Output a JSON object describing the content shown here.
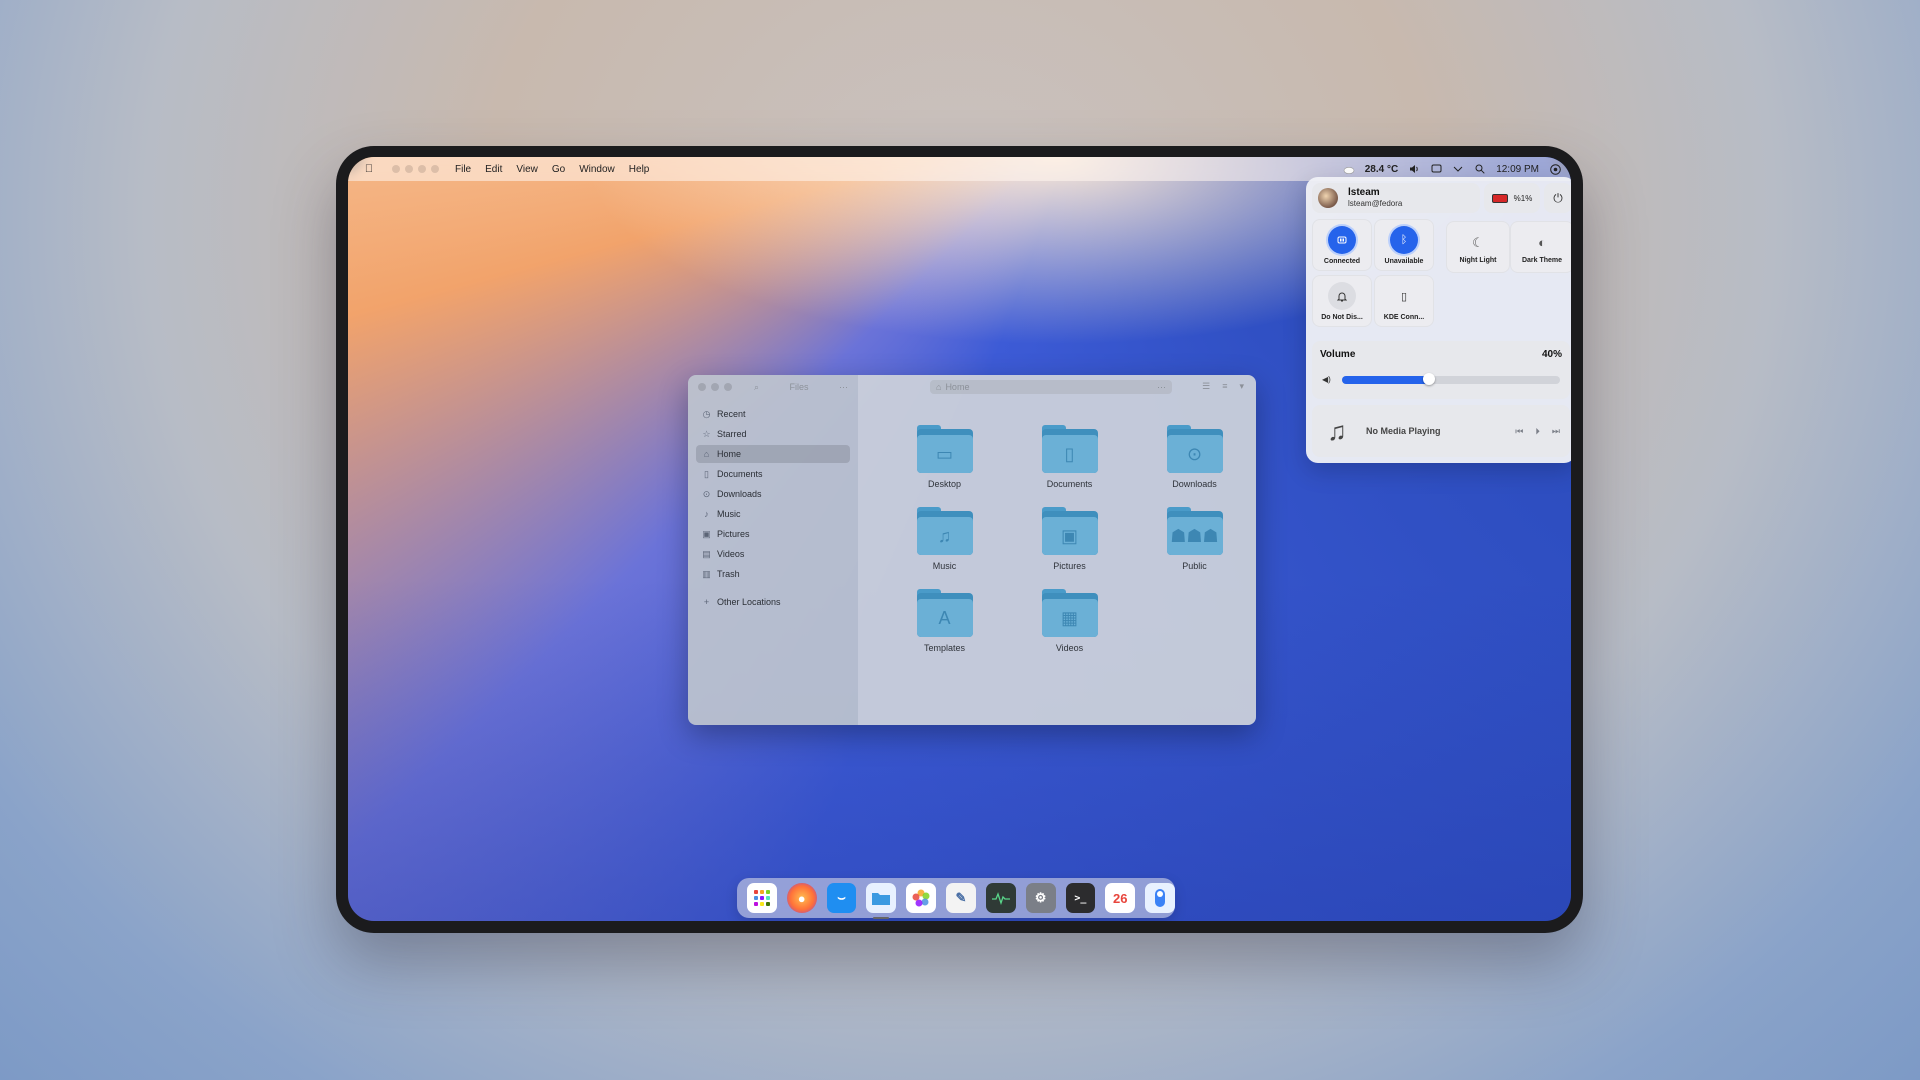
{
  "menubar": {
    "menus": [
      "File",
      "Edit",
      "View",
      "Go",
      "Window",
      "Help"
    ],
    "temperature": "28.4 °C",
    "clock": "12:09 PM"
  },
  "files": {
    "sidebar_title": "Files",
    "path": "Home",
    "sidebar_items": [
      {
        "label": "Recent",
        "icon": "clock-icon"
      },
      {
        "label": "Starred",
        "icon": "star-icon"
      },
      {
        "label": "Home",
        "icon": "home-icon",
        "active": true
      },
      {
        "label": "Documents",
        "icon": "document-icon"
      },
      {
        "label": "Downloads",
        "icon": "download-icon"
      },
      {
        "label": "Music",
        "icon": "music-icon"
      },
      {
        "label": "Pictures",
        "icon": "picture-icon"
      },
      {
        "label": "Videos",
        "icon": "video-icon"
      },
      {
        "label": "Trash",
        "icon": "trash-icon"
      }
    ],
    "other_locations": "Other Locations",
    "folders": [
      {
        "label": "Desktop",
        "icon": "desktop-icon"
      },
      {
        "label": "Documents",
        "icon": "document-icon"
      },
      {
        "label": "Downloads",
        "icon": "download-icon"
      },
      {
        "label": "Music",
        "icon": "music-icon"
      },
      {
        "label": "Pictures",
        "icon": "picture-icon"
      },
      {
        "label": "Public",
        "icon": "people-icon"
      },
      {
        "label": "Templates",
        "icon": "templates-icon"
      },
      {
        "label": "Videos",
        "icon": "film-icon"
      }
    ]
  },
  "quick_settings": {
    "user_name": "lsteam",
    "user_host": "lsteam@fedora",
    "battery": "%1%",
    "tiles": [
      {
        "label": "Connected",
        "icon": "wifi-icon",
        "on": true
      },
      {
        "label": "Unavailable",
        "icon": "bluetooth-icon",
        "on": true
      },
      {
        "label": "Night Light",
        "icon": "night-light-icon",
        "on": false
      },
      {
        "label": "Dark Theme",
        "icon": "dark-theme-icon",
        "on": false
      },
      {
        "label": "Do Not Dis...",
        "icon": "bell-icon",
        "on": false
      },
      {
        "label": "KDE Conn...",
        "icon": "phone-icon",
        "on": false
      }
    ],
    "volume_title": "Volume",
    "volume_pct": "40%",
    "volume_level": 0.4,
    "media_text": "No Media Playing"
  },
  "dock": {
    "apps": [
      {
        "name": "app-grid",
        "icon": "grid-icon",
        "color": "#ffffff"
      },
      {
        "name": "firefox",
        "icon": "firefox-icon",
        "color": "#ff7139"
      },
      {
        "name": "software",
        "icon": "bag-icon",
        "color": "#1f8ef1"
      },
      {
        "name": "files",
        "icon": "folder-icon",
        "color": "#e8f1ff",
        "active": true
      },
      {
        "name": "photos",
        "icon": "photos-icon",
        "color": "#ffffff"
      },
      {
        "name": "text-editor",
        "icon": "pen-icon",
        "color": "#f3f3f3"
      },
      {
        "name": "system-monitor",
        "icon": "activity-icon",
        "color": "#2f3a36"
      },
      {
        "name": "settings",
        "icon": "gear-icon",
        "color": "#7b7f88"
      },
      {
        "name": "terminal",
        "icon": "terminal-icon",
        "color": "#2c2c2e"
      },
      {
        "name": "calendar",
        "icon": "calendar-icon",
        "color": "#ffffff",
        "day": "26"
      },
      {
        "name": "toggle",
        "icon": "switch-icon",
        "color": "#e8f1ff"
      }
    ]
  }
}
